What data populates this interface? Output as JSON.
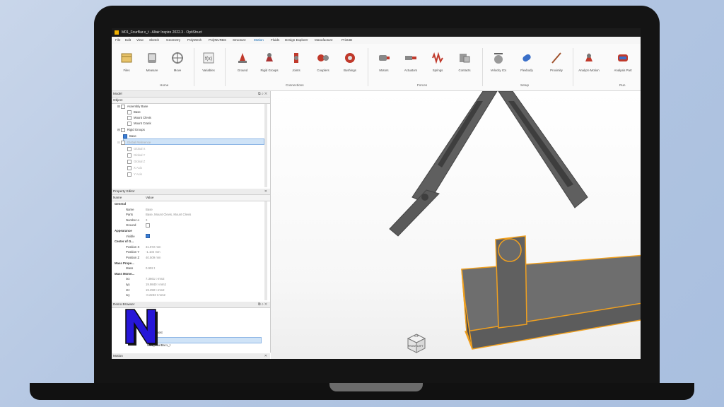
{
  "window": {
    "title": "M01_FourBar.x_t - Altair Inspire 2022.3 - OptiStruct"
  },
  "menu": [
    "File",
    "Edit",
    "View",
    "Sketch",
    "Geometry",
    "PolyMesh",
    "PolyNURBS",
    "Structure",
    "Motion",
    "Fluids",
    "Design Explorer",
    "Manufacture",
    "Print3D"
  ],
  "active_menu": "Motion",
  "ribbon": {
    "tools": [
      "Files",
      "Measure",
      "Move",
      "Variables",
      "Ground",
      "Rigid Groups",
      "Joints",
      "Couplers",
      "Bushings",
      "Motors",
      "Actuators",
      "Springs",
      "Contacts",
      "Velocity ICs",
      "Flexbody",
      "Proximity",
      "Analyze Motion",
      "Analysis Part"
    ],
    "groups": {
      "home": "Home",
      "connections": "Connections",
      "forces": "Forces",
      "setup": "Setup",
      "run": "Run"
    }
  },
  "model_panel": {
    "title": "Model",
    "column": "Object",
    "tree": [
      "Assembly Base",
      "Base",
      "Mount Clevis",
      "Mount Crank",
      "Rigid Groups",
      "Base",
      "Global Reference",
      "Global X",
      "Global Y",
      "Global Z",
      "X Axis",
      "Y Axis"
    ]
  },
  "property_editor": {
    "title": "Property Editor",
    "columns": [
      "Name",
      "Value"
    ],
    "rows": [
      {
        "name": "General",
        "value": ""
      },
      {
        "name": "Name",
        "value": "Base"
      },
      {
        "name": "Parts",
        "value": "Base, Mount Clevis, Mount Clevis"
      },
      {
        "name": "Number o",
        "value": "3"
      },
      {
        "name": "Ground",
        "value": ""
      },
      {
        "name": "Appearance",
        "value": ""
      },
      {
        "name": "Visible",
        "value": ""
      },
      {
        "name": "Center of G...",
        "value": ""
      },
      {
        "name": "Position X",
        "value": "31.972 mm"
      },
      {
        "name": "Position Y",
        "value": "-1.104 mm"
      },
      {
        "name": "Position Z",
        "value": "40.509 mm"
      },
      {
        "name": "Mass Prope...",
        "value": ""
      },
      {
        "name": "Mass",
        "value": "0.902 t"
      },
      {
        "name": "Mass Mome...",
        "value": ""
      },
      {
        "name": "Ixx",
        "value": "7.3661 t·mm2"
      },
      {
        "name": "Iyy",
        "value": "19.9840 t·mm2"
      },
      {
        "name": "Izz",
        "value": "19.250 t·mm2"
      },
      {
        "name": "Ixy",
        "value": "-0.2233 t·mm2"
      }
    ]
  },
  "demo_browser": {
    "title": "Demo Browser",
    "items": [
      "ar almost",
      "x_t",
      "M01_FourBar.x_t"
    ]
  },
  "motion_panel": {
    "title": "Motion"
  },
  "viewcube": {
    "top": "TOP",
    "left": "LEFT",
    "front": "FRONT"
  },
  "colors": {
    "accent": "#0a64b0",
    "highlight": "#f0a020",
    "model": "#6e6e6e"
  }
}
